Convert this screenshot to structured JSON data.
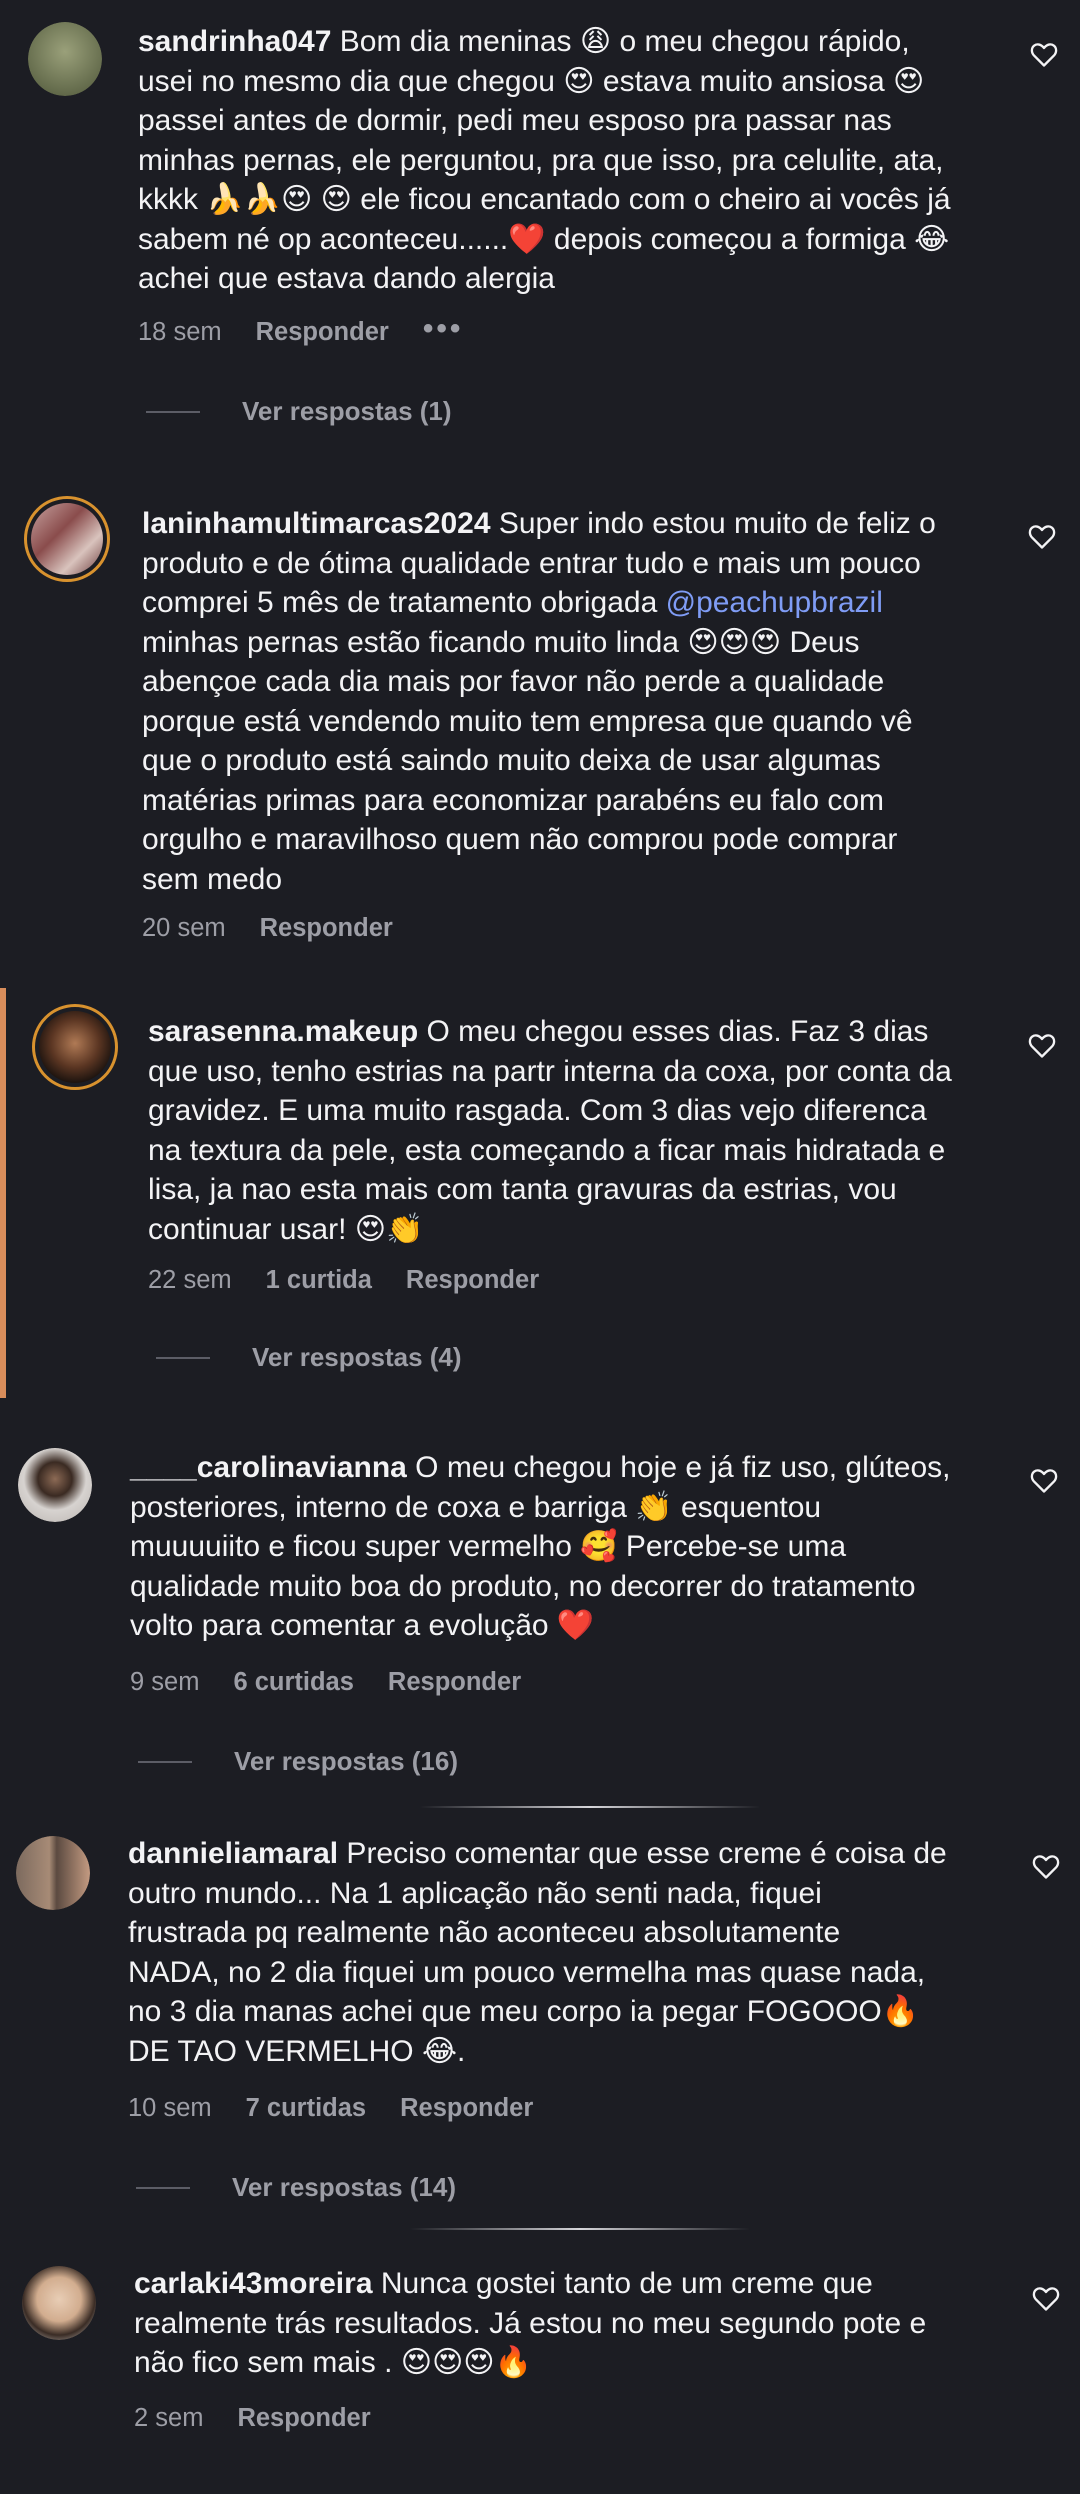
{
  "comments": [
    {
      "username": "sandrinha047",
      "text": " Bom dia meninas 😩 o meu chegou rápido,\nusei no mesmo dia que chegou 😍 estava muito ansiosa 😍\npassei antes de dormir, pedi meu esposo pra passar nas\nminhas pernas, ele perguntou, pra que isso, pra celulite, ata,\nkkkk 🍌🍌😍 😍 ele ficou encantado com o cheiro ai vocês já\nsabem né op aconteceu......❤️ depois começou a formiga 😂\nachei que estava dando alergia",
      "time": "18 sem",
      "reply_label": "Responder",
      "more": "•••",
      "view_replies": "Ver respostas (1)",
      "avatar_color": "#6f7a55"
    },
    {
      "username": "laninhamultimarcas2024",
      "text_before": " Super indo estou muito de feliz o\nproduto e de ótima qualidade entrar tudo e mais um pouco\ncomprei 5 mês de tratamento obrigada ",
      "mention": "@peachupbrazil",
      "text_after": "\nminhas pernas estão ficando muito linda 😍😍😍 Deus\nabençoe cada dia mais por favor não perde a qualidade\nporque está vendendo muito tem empresa que quando vê\nque o produto está saindo muito deixa de usar algumas\nmatérias primas para economizar parabéns eu falo com\norgulho e maravilhoso quem não comprou pode comprar\nsem medo",
      "time": "20 sem",
      "reply_label": "Responder",
      "avatar_color": "#a26d6a"
    },
    {
      "username": "sarasenna.makeup",
      "text": " O meu chegou esses dias. Faz 3 dias\nque uso, tenho estrias na partr interna da coxa, por conta da\ngravidez. E uma muito rasgada. Com 3 dias vejo diferenca\nna textura da pele, esta começando a ficar mais hidratada e\nlisa, ja nao esta mais com tanta gravuras da estrias, vou\ncontinuar usar! 😍👏",
      "time": "22 sem",
      "likes": "1 curtida",
      "reply_label": "Responder",
      "view_replies": "Ver respostas (4)",
      "avatar_color": "#3a2a22"
    },
    {
      "username": "____carolinavianna",
      "text": " O meu chegou hoje e já fiz uso, glúteos,\nposteriores, interno de coxa e barriga 👏 esquentou\nmuuuuiito e ficou super vermelho 🥰 Percebe-se uma\nqualidade muito boa do produto, no decorrer do tratamento\nvolto para comentar a evolução ❤️",
      "time": "9 sem",
      "likes": "6 curtidas",
      "reply_label": "Responder",
      "view_replies": "Ver respostas (16)",
      "avatar_color": "#c9c4c2"
    },
    {
      "username": "dannieliamaral",
      "text": " Preciso comentar que esse creme é coisa de\noutro mundo... Na 1 aplicação não senti nada, fiquei\nfrustrada pq realmente não aconteceu absolutamente\nNADA, no 2 dia fiquei um pouco vermelha mas quase nada,\nno 3 dia manas achei que meu corpo ia pegar FOGOOO🔥\nDE TAO VERMELHO 😂.",
      "time": "10 sem",
      "likes": "7 curtidas",
      "reply_label": "Responder",
      "view_replies": "Ver respostas (14)",
      "avatar_color": "#8a6a5a"
    },
    {
      "username": "carlaki43moreira",
      "text": " Nunca gostei tanto de um creme que\nrealmente trás resultados. Já estou no meu segundo pote e\nnão fico sem mais . 😍😍😍🔥",
      "time": "2 sem",
      "reply_label": "Responder",
      "avatar_color": "#d9b89a"
    }
  ],
  "colors": {
    "background": "#1c1d23",
    "text": "#f3f3f5",
    "muted": "#9d9ea6",
    "mention": "#7f9cf5",
    "story_ring": "#d8922e"
  },
  "icons": {
    "heart": "heart-outline-icon"
  }
}
